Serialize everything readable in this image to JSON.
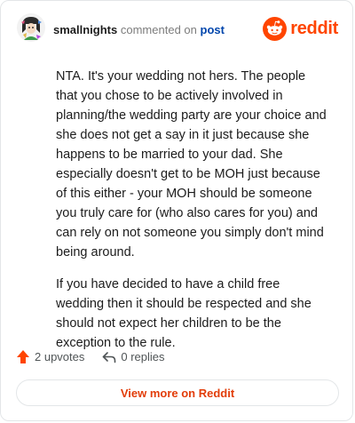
{
  "header": {
    "username": "smallnights",
    "action_text": "commented on",
    "post_link": "post",
    "brand": "reddit",
    "avatar_icon": "user-avatar-illustration",
    "brand_icon": "reddit-snoo-icon"
  },
  "comment": {
    "paragraphs": [
      "NTA. It's your wedding not hers. The people that you chose to be actively involved in planning/the wedding party are your choice and she does not get a say in it just because she happens to be married to your dad. She especially doesn't get to be MOH just because of this either - your MOH should be someone you truly care for (who also cares for you) and can rely on not someone you simply don't mind being around.",
      "If you have decided to have a child free wedding then it should be respected and she should not expect her children to be the exception to the rule."
    ]
  },
  "actions": {
    "upvotes": "2 upvotes",
    "replies": "0 replies",
    "upvote_icon": "upvote-arrow-icon",
    "reply_icon": "reply-arrow-icon"
  },
  "footer": {
    "view_more": "View more on Reddit"
  },
  "colors": {
    "brand": "#ff4500",
    "link": "#0045ac",
    "cta": "#e23d0a",
    "muted": "#7c7c7c"
  }
}
